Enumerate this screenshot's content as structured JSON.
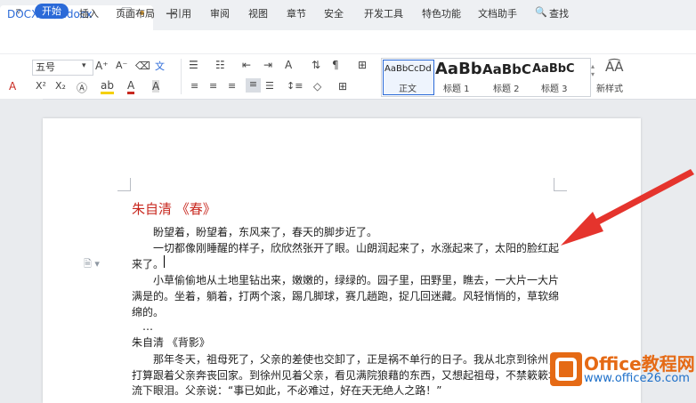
{
  "tab": {
    "title": "DOCX 文档.docx"
  },
  "menu": {
    "collapse": "▿",
    "items": [
      "开始",
      "插入",
      "页面布局",
      "引用",
      "审阅",
      "视图",
      "章节",
      "安全",
      "开发工具",
      "特色功能",
      "文档助手",
      "查找"
    ]
  },
  "ribbon": {
    "font_size": "五号",
    "styles": [
      {
        "sample": "AaBbCcDd",
        "label": "正文"
      },
      {
        "sample": "AaBb",
        "label": "标题 1"
      },
      {
        "sample": "AaBbC",
        "label": "标题 2"
      },
      {
        "sample": "AaBbC",
        "label": "标题 3"
      }
    ],
    "new_style": "新样式"
  },
  "document": {
    "heading": "朱自清 《春》",
    "lines": [
      "盼望着，盼望着，东风来了，春天的脚步近了。",
      "一切都像刚睡醒的样子，欣欣然张开了眼。山朗润起来了，水涨起来了，太阳的脸红起",
      "来了。",
      "小草偷偷地从土地里钻出来，嫩嫩的，绿绿的。园子里，田野里，瞧去，一大片一大片",
      "满是的。坐着，躺着，打两个滚，踢几脚球，赛几趟跑，捉几回迷藏。风轻悄悄的，草软绵",
      "绵的。",
      "…",
      "朱自清 《背影》",
      "那年冬天，祖母死了，父亲的差使也交卸了，正是祸不单行的日子。我从北京到徐州，",
      "打算跟着父亲奔丧回家。到徐州见着父亲，看见满院狼藉的东西，又想起祖母，不禁簌簌地",
      "流下眼泪。父亲说：“事已如此，不必难过，好在天无绝人之路！”"
    ]
  },
  "watermark": {
    "title": "Office教程网",
    "url": "www.office26.com"
  },
  "colors": {
    "accent": "#2b6ad8",
    "heading": "#c8281f",
    "arrow": "#e5342d",
    "watermark": "#e56a15"
  }
}
